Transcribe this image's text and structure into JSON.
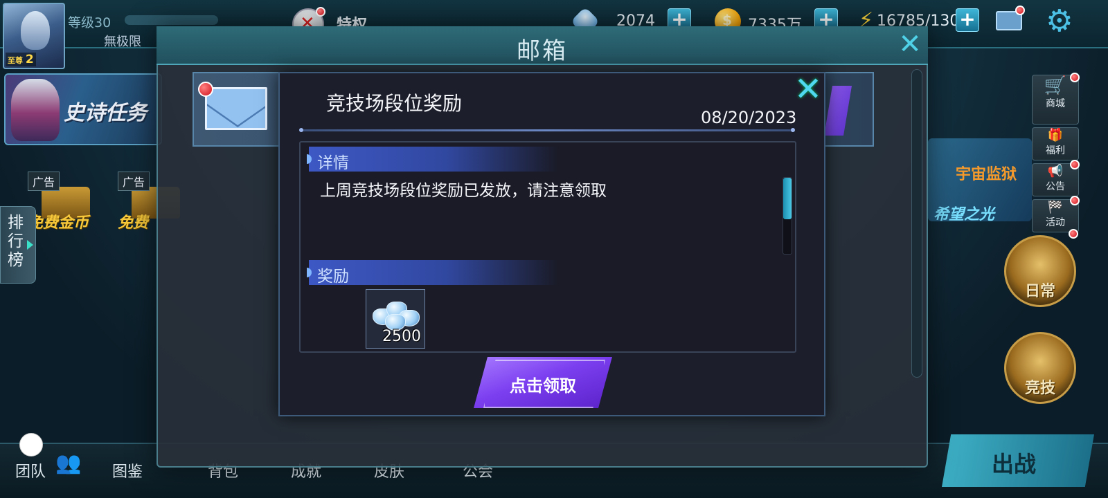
{
  "hud": {
    "level_label": "等级30",
    "rank_text": "無极限",
    "vip_label": "至尊",
    "vip_level": "2",
    "privilege_label": "特权",
    "diamonds": "2074",
    "gold": "7335万",
    "energy": "16785/130",
    "plus_symbol": "+"
  },
  "left": {
    "banner_text": "史诗任务",
    "ad_tag": "广告",
    "ad_free_gold": "免费金币",
    "ad_free_other": "免费",
    "rank_tab": "排行榜"
  },
  "right": {
    "shop": "商城",
    "welfare": "福利",
    "notice": "公告",
    "activity": "活动",
    "daily": "日常",
    "arena": "竞技",
    "banner_t1": "宇宙监狱",
    "banner_t2": "希望之光"
  },
  "bottom": {
    "team": "团队",
    "codex": "图鉴",
    "bag": "背包",
    "achieve": "成就",
    "skin": "皮肤",
    "guild": "公会",
    "go": "出战"
  },
  "mailbox": {
    "title": "邮箱",
    "close_symbol": "✕"
  },
  "mail_detail": {
    "title": "竞技场段位奖励",
    "date": "08/20/2023",
    "close_symbol": "✕",
    "details_header": "详情",
    "body": "上周竞技场段位奖励已发放，请注意领取",
    "rewards_header": "奖励",
    "rewards": [
      {
        "item": "diamond-bundle-icon",
        "quantity": "2500"
      }
    ],
    "claim_button": "点击领取"
  },
  "colors": {
    "accent_cyan": "#4fd8f0",
    "claim_purple": "#7c3ff0",
    "section_blue": "#3d58c4",
    "notification_red": "#d0101a"
  }
}
